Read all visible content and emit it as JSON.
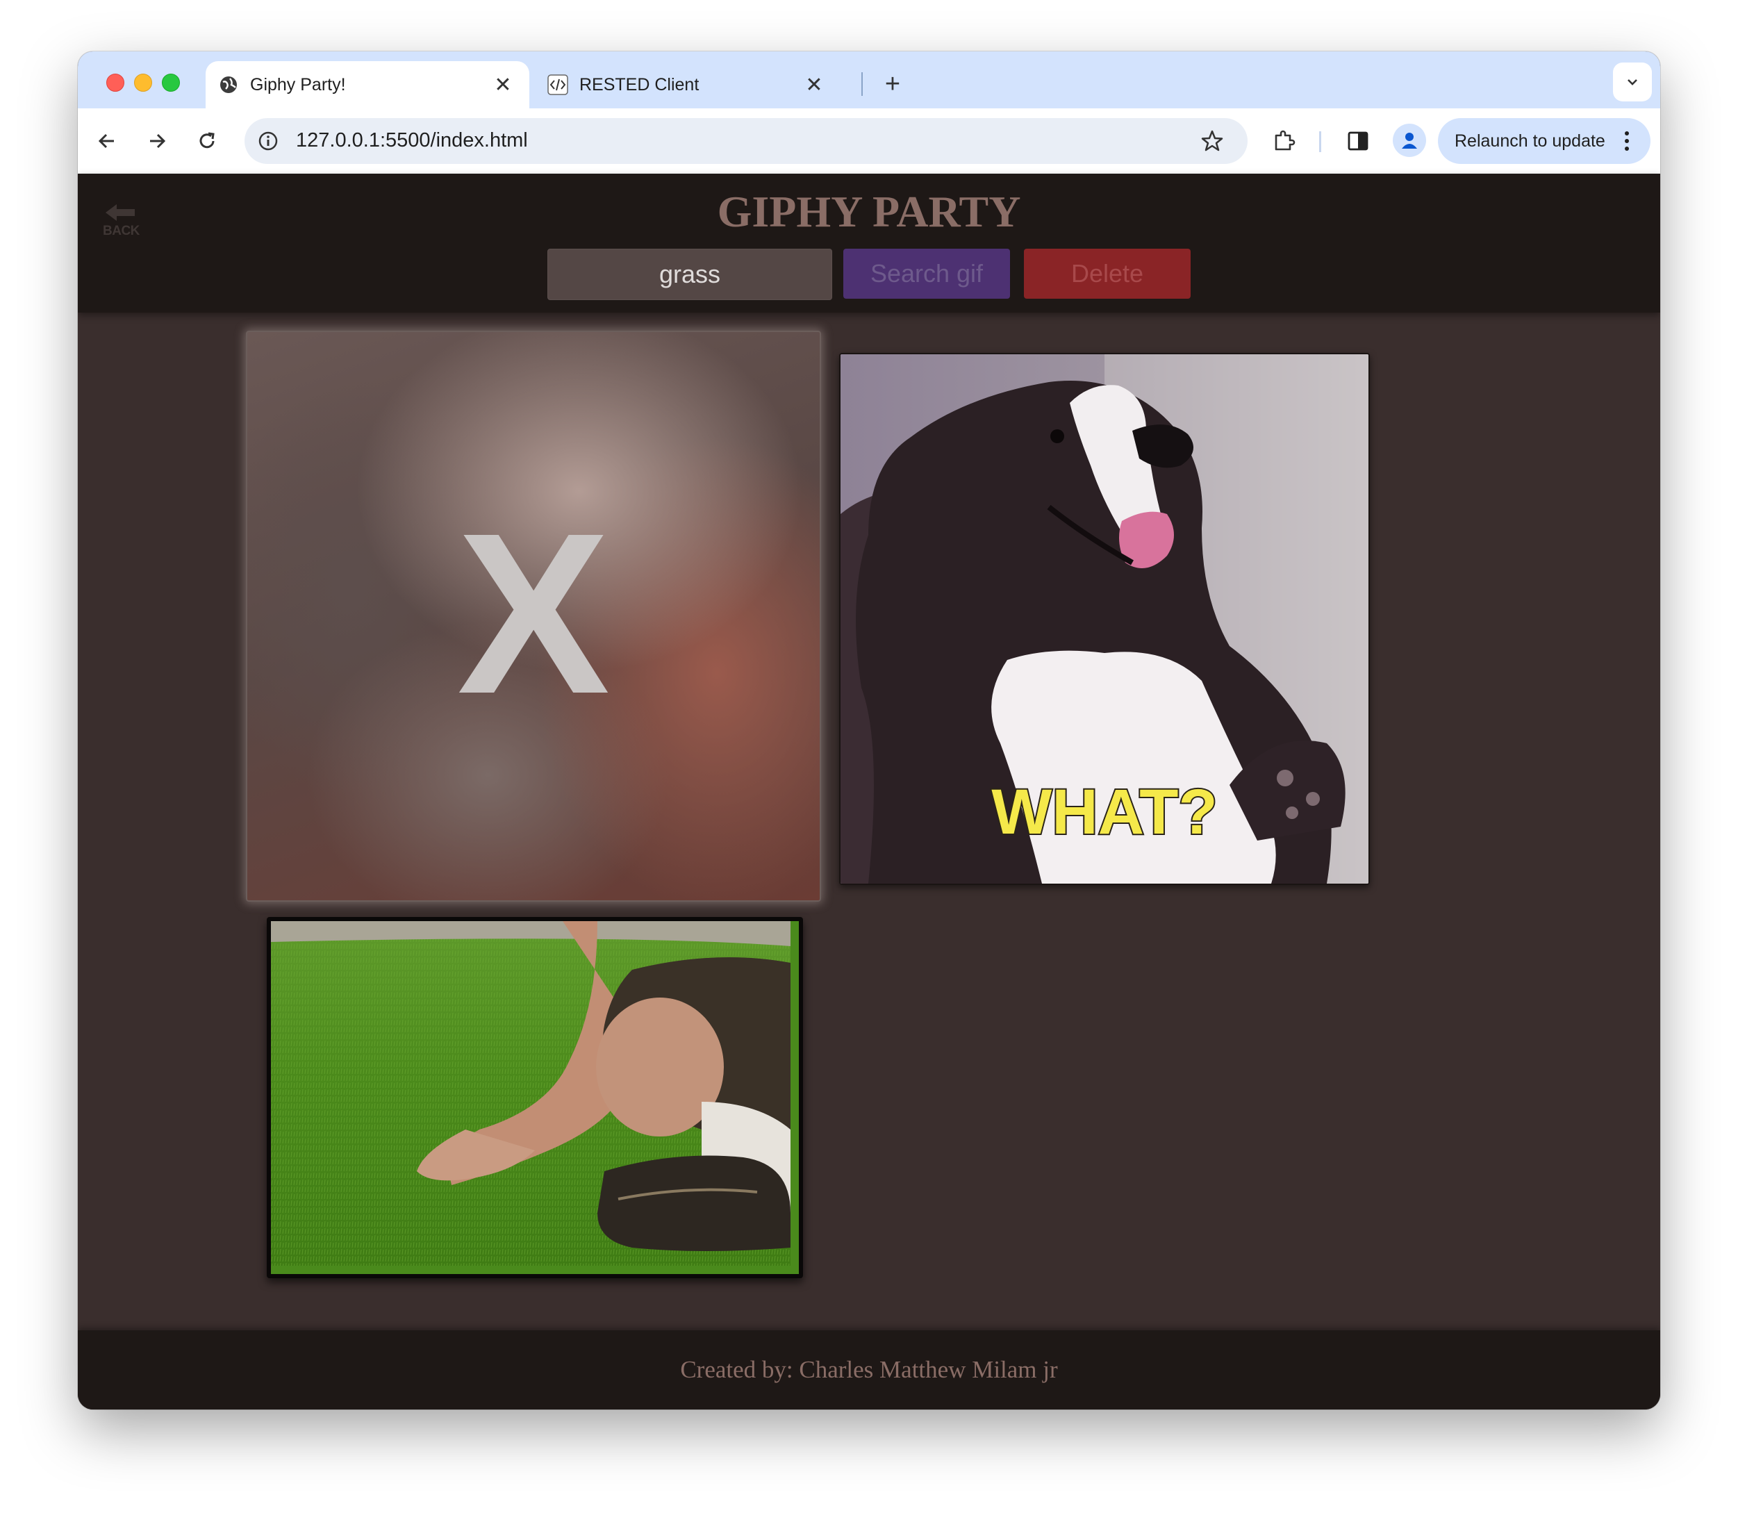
{
  "browser": {
    "tabs": [
      {
        "title": "Giphy Party!",
        "active": true,
        "favicon": "globe-icon"
      },
      {
        "title": "RESTED Client",
        "active": false,
        "favicon": "code-icon"
      }
    ],
    "url": "127.0.0.1:5500/index.html",
    "relaunch_label": "Relaunch to update"
  },
  "page": {
    "back_label": "BACK",
    "title": "GIPHY PARTY",
    "search": {
      "value": "grass"
    },
    "search_button_label": "Search gif",
    "delete_button_label": "Delete",
    "footer_text": "Created by: Charles Matthew Milam jr"
  },
  "gifs": [
    {
      "id": "blurred-gif",
      "overlay_text": "X"
    },
    {
      "id": "dog-gif",
      "caption": "WHAT?"
    },
    {
      "id": "grass-gif"
    }
  ],
  "colors": {
    "header_bg": "#1e1816",
    "page_bg": "#3a2e2d",
    "title": "#8a6d66",
    "search_button": "#4d3172",
    "delete_button": "#8a2426",
    "tabstrip": "#d3e3fd"
  }
}
